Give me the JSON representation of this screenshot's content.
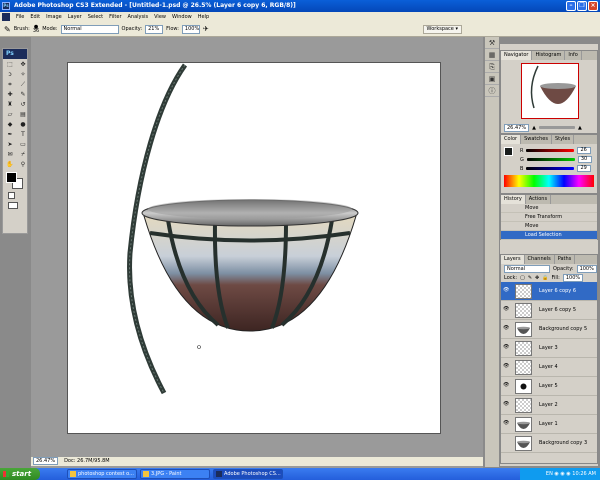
{
  "window": {
    "title": "Adobe Photoshop CS3 Extended - [Untitled-1.psd @ 26.5% (Layer 6 copy 6, RGB/8)]"
  },
  "menu": [
    "File",
    "Edit",
    "Image",
    "Layer",
    "Select",
    "Filter",
    "Analysis",
    "View",
    "Window",
    "Help"
  ],
  "options": {
    "brush_label": "Brush:",
    "brush_size": "36",
    "mode_label": "Mode:",
    "mode_value": "Normal",
    "opacity_label": "Opacity:",
    "opacity_value": "21%",
    "flow_label": "Flow:",
    "flow_value": "100%",
    "workspace": "Workspace"
  },
  "toolbox": {
    "logo": "Ps"
  },
  "status": {
    "zoom": "26.47%",
    "doc": "Doc: 26.7M/95.8M"
  },
  "navigator": {
    "tabs": [
      "Navigator",
      "Histogram",
      "Info"
    ],
    "zoom": "26.47%"
  },
  "color": {
    "tabs": [
      "Color",
      "Swatches",
      "Styles"
    ],
    "channels": [
      {
        "label": "R",
        "value": "26",
        "color": "#c0392b"
      },
      {
        "label": "G",
        "value": "30",
        "color": "#2e8b3a"
      },
      {
        "label": "B",
        "value": "29",
        "color": "#2b3fae"
      }
    ]
  },
  "history": {
    "tabs": [
      "History",
      "Actions"
    ],
    "items": [
      {
        "label": "Move",
        "selected": false
      },
      {
        "label": "Free Transform",
        "selected": false
      },
      {
        "label": "Move",
        "selected": false
      },
      {
        "label": "Load Selection",
        "selected": true
      }
    ]
  },
  "layers_panel": {
    "tabs": [
      "Layers",
      "Channels",
      "Paths"
    ],
    "blend_mode": "Normal",
    "opacity_label": "Opacity:",
    "opacity_value": "100%",
    "lock_label": "Lock:",
    "fill_label": "Fill:",
    "fill_value": "100%",
    "layers": [
      {
        "name": "Layer 6 copy 6",
        "selected": true,
        "visible": true,
        "thumb": "checker"
      },
      {
        "name": "Layer 6 copy 5",
        "selected": false,
        "visible": true,
        "thumb": "checker"
      },
      {
        "name": "Background copy 5",
        "selected": false,
        "visible": true,
        "thumb": "bowl"
      },
      {
        "name": "Layer 3",
        "selected": false,
        "visible": true,
        "thumb": "checker"
      },
      {
        "name": "Layer 4",
        "selected": false,
        "visible": true,
        "thumb": "checker"
      },
      {
        "name": "Layer 5",
        "selected": false,
        "visible": true,
        "thumb": "dot"
      },
      {
        "name": "Layer 2",
        "selected": false,
        "visible": true,
        "thumb": "checker"
      },
      {
        "name": "Layer 1",
        "selected": false,
        "visible": true,
        "thumb": "bowl"
      },
      {
        "name": "Background copy 3",
        "selected": false,
        "visible": false,
        "thumb": "bowl"
      }
    ]
  },
  "taskbar": {
    "start": "start",
    "tasks": [
      {
        "label": "photoshop contest o...",
        "active": false
      },
      {
        "label": "3.JPG - Paint",
        "active": false
      },
      {
        "label": "Adobe Photoshop CS...",
        "active": true
      }
    ],
    "lang": "EN",
    "clock": "10:26 AM"
  }
}
